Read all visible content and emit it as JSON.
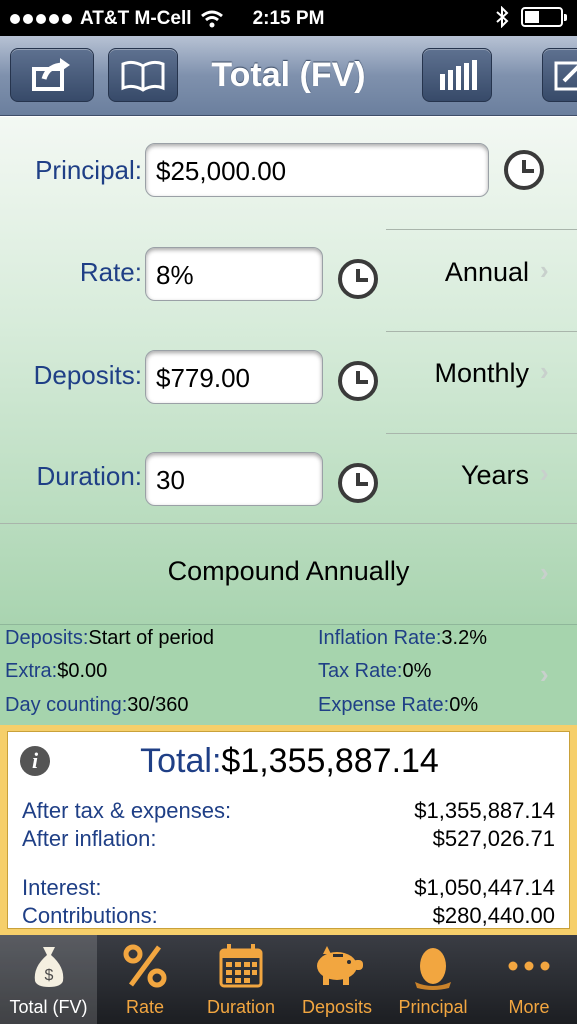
{
  "status": {
    "carrier": "AT&T M-Cell",
    "time": "2:15 PM"
  },
  "nav": {
    "title": "Total (FV)"
  },
  "form": {
    "principal": {
      "label": "Principal:",
      "value": "$25,000.00"
    },
    "rate": {
      "label": "Rate:",
      "value": "8%",
      "period": "Annual"
    },
    "deposits": {
      "label": "Deposits:",
      "value": "$779.00",
      "frequency": "Monthly"
    },
    "duration": {
      "label": "Duration:",
      "value": "30",
      "unit": "Years"
    },
    "compounding": "Compound Annually"
  },
  "options": {
    "deposits": {
      "label": "Deposits:",
      "value": "Start of period"
    },
    "extra": {
      "label": "Extra:",
      "value": "$0.00"
    },
    "day_counting": {
      "label": "Day counting:",
      "value": "30/360"
    },
    "inflation": {
      "label": "Inflation Rate:",
      "value": "3.2%"
    },
    "tax": {
      "label": "Tax Rate:",
      "value": "0%"
    },
    "expense": {
      "label": "Expense Rate:",
      "value": "0%"
    }
  },
  "results": {
    "total_label": "Total:",
    "total_value": "$1,355,887.14",
    "rows": [
      {
        "label": "After tax & expenses:",
        "value": "$1,355,887.14"
      },
      {
        "label": "After inflation:",
        "value": "$527,026.71"
      },
      {
        "label": "Interest:",
        "value": "$1,050,447.14"
      },
      {
        "label": "Contributions:",
        "value": "$280,440.00"
      }
    ]
  },
  "tabs": [
    {
      "label": "Total (FV)",
      "icon": "money-bag-icon",
      "active": true
    },
    {
      "label": "Rate",
      "icon": "percent-icon"
    },
    {
      "label": "Duration",
      "icon": "calendar-icon"
    },
    {
      "label": "Deposits",
      "icon": "piggy-bank-icon"
    },
    {
      "label": "Principal",
      "icon": "egg-icon"
    },
    {
      "label": "More",
      "icon": "more-dots-icon"
    }
  ],
  "colors": {
    "label_blue": "#1f3f86",
    "tab_orange": "#f2a640",
    "results_border": "#f6cf6a",
    "nav_blue": "#7f91ad"
  }
}
